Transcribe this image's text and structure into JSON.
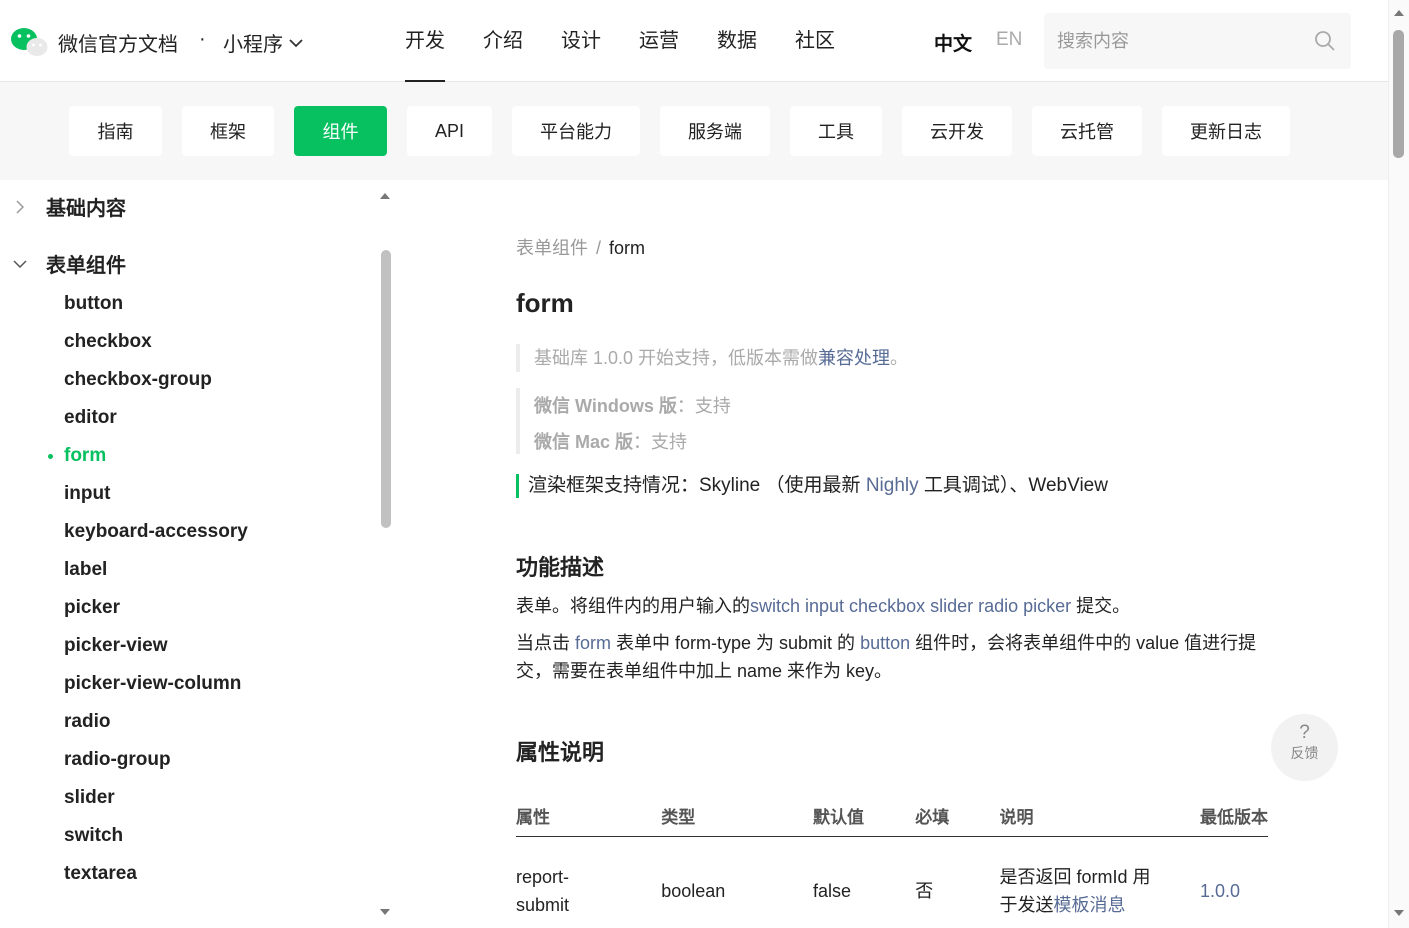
{
  "header": {
    "brand": "微信官方文档",
    "dot": "·",
    "product": "小程序",
    "nav": [
      "开发",
      "介绍",
      "设计",
      "运营",
      "数据",
      "社区"
    ],
    "lang_zh": "中文",
    "lang_en": "EN",
    "search_placeholder": "搜索内容"
  },
  "subnav": [
    "指南",
    "框架",
    "组件",
    "API",
    "平台能力",
    "服务端",
    "工具",
    "云开发",
    "云托管",
    "更新日志"
  ],
  "sidebar": {
    "groups": [
      "基础内容",
      "表单组件"
    ],
    "items": [
      "button",
      "checkbox",
      "checkbox-group",
      "editor",
      "form",
      "input",
      "keyboard-accessory",
      "label",
      "picker",
      "picker-view",
      "picker-view-column",
      "radio",
      "radio-group",
      "slider",
      "switch",
      "textarea"
    ],
    "active_item": "form"
  },
  "content": {
    "breadcrumb_parent": "表单组件",
    "breadcrumb_sep": "/",
    "breadcrumb_current": "form",
    "title": "form",
    "lib_note": "基础库 1.0.0 开始支持，低版本需做",
    "lib_note_link": "兼容处理",
    "lib_note_end": "。",
    "win_label": "微信 Windows 版",
    "win_value": "：支持",
    "mac_label": "微信 Mac 版",
    "mac_value": "：支持",
    "render_prefix": "渲染框架支持情况：Skyline （使用最新 ",
    "render_link": "Nighly",
    "render_suffix": " 工具调试）、WebView",
    "desc_heading": "功能描述",
    "desc_p1_prefix": "表单。将组件内的用户输入的",
    "desc_p1_link": "switch input checkbox slider radio picker",
    "desc_p1_suffix": " 提交。",
    "desc_p2_a": "当点击 ",
    "desc_p2_link1": "form",
    "desc_p2_b": " 表单中 form-type 为 submit 的 ",
    "desc_p2_link2": "button",
    "desc_p2_c": " 组件时，会将表单组件中的 value 值进行提交，需要在表单组件中加上 name 来作为 key。",
    "props_heading": "属性说明",
    "table_headers": [
      "属性",
      "类型",
      "默认值",
      "必填",
      "说明",
      "最低版本"
    ],
    "row": {
      "attr": "report-submit",
      "type": "boolean",
      "default": "false",
      "required": "否",
      "desc_a": "是否返回 formId 用于发送",
      "desc_link": "模板消息",
      "version": "1.0.0"
    }
  },
  "feedback": {
    "symbol": "?",
    "label": "反馈"
  },
  "colors": {
    "accent": "#07c160",
    "link": "#576b95"
  }
}
